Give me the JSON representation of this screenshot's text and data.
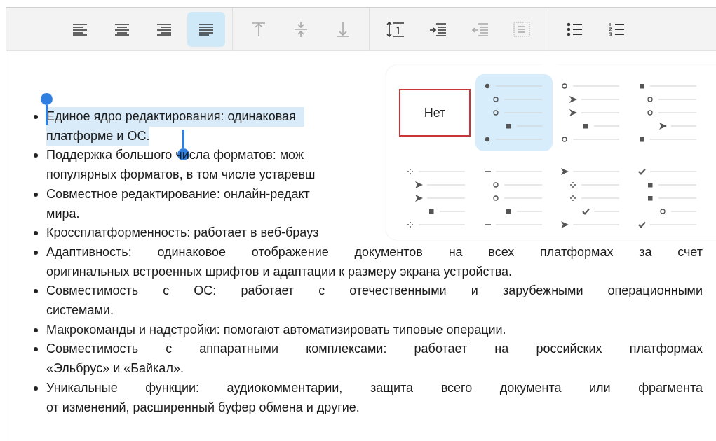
{
  "toolbar": {
    "groups": [
      [
        {
          "kind": "left",
          "selected": false,
          "disabled": false
        },
        {
          "kind": "center",
          "selected": false,
          "disabled": false
        },
        {
          "kind": "right",
          "selected": false,
          "disabled": false
        },
        {
          "kind": "justify",
          "selected": true,
          "disabled": false
        }
      ],
      [
        {
          "kind": "top",
          "selected": false,
          "disabled": true
        },
        {
          "kind": "middle",
          "selected": false,
          "disabled": true
        },
        {
          "kind": "bottom",
          "selected": false,
          "disabled": true
        }
      ],
      [
        {
          "kind": "spacing",
          "selected": false,
          "disabled": false
        },
        {
          "kind": "indent",
          "selected": false,
          "disabled": false
        },
        {
          "kind": "outdent",
          "selected": false,
          "disabled": true
        },
        {
          "kind": "wrap",
          "selected": false,
          "disabled": true
        }
      ],
      [
        {
          "kind": "bullets",
          "selected": false,
          "disabled": false
        },
        {
          "kind": "numbers",
          "selected": false,
          "disabled": false
        }
      ]
    ]
  },
  "document": {
    "items": [
      {
        "selected": true,
        "lines": [
          "Единое ядро редактирования: одинаковая",
          "платформе и ОС."
        ]
      },
      {
        "selected": false,
        "lines": [
          "Поддержка большого числа форматов: мож",
          "популярных форматов, в том числе устаревш"
        ]
      },
      {
        "selected": false,
        "lines": [
          "Совместное редактирование: онлайн-редакт",
          "мира."
        ]
      },
      {
        "selected": false,
        "lines": [
          "Кроссплатформенность: работает в веб-брауз"
        ]
      },
      {
        "selected": false,
        "lines": [
          "Адаптивность: одинаковое отображение документов на всех платформах за счет",
          "оригинальных встроенных шрифтов и адаптации к размеру экрана устройства."
        ]
      },
      {
        "selected": false,
        "lines": [
          "Совместимость с ОС: работает с отечественными и зарубежными операционными",
          "системами."
        ]
      },
      {
        "selected": false,
        "lines": [
          "Макрокоманды и надстройки: помогают автоматизировать типовые операции."
        ]
      },
      {
        "selected": false,
        "lines": [
          "Совместимость с аппаратными комплексами: работает на российских платформах",
          "«Эльбрус» и «Байкал»."
        ]
      },
      {
        "selected": false,
        "lines": [
          "Уникальные функции: аудиокомментарии, защита всего документа или фрагмента",
          "от изменений, расширенный буфер обмена и другие."
        ]
      }
    ]
  },
  "bullet_popover": {
    "options": [
      {
        "kind": "none",
        "label": "Нет",
        "selected": false,
        "focused": true
      },
      {
        "kind": "style",
        "markers": [
          {
            "kind": "dot"
          },
          {
            "kind": "circle"
          },
          {
            "kind": "circle"
          },
          {
            "kind": "square"
          },
          {
            "kind": "dot"
          }
        ],
        "selected": true,
        "focused": false
      },
      {
        "kind": "style",
        "markers": [
          {
            "kind": "circle"
          },
          {
            "kind": "arrow"
          },
          {
            "kind": "arrow"
          },
          {
            "kind": "square"
          },
          {
            "kind": "circle"
          }
        ],
        "selected": false,
        "focused": false
      },
      {
        "kind": "style",
        "markers": [
          {
            "kind": "square"
          },
          {
            "kind": "circle"
          },
          {
            "kind": "circle"
          },
          {
            "kind": "arrow"
          },
          {
            "kind": "square"
          }
        ],
        "selected": false,
        "focused": false
      },
      {
        "kind": "style",
        "markers": [
          {
            "kind": "dots"
          },
          {
            "kind": "arrow"
          },
          {
            "kind": "arrow"
          },
          {
            "kind": "square"
          },
          {
            "kind": "dots"
          }
        ],
        "selected": false,
        "focused": false
      },
      {
        "kind": "style",
        "markers": [
          {
            "kind": "dash"
          },
          {
            "kind": "circle"
          },
          {
            "kind": "circle"
          },
          {
            "kind": "square"
          },
          {
            "kind": "dash"
          }
        ],
        "selected": false,
        "focused": false
      },
      {
        "kind": "style",
        "markers": [
          {
            "kind": "arrow"
          },
          {
            "kind": "dots"
          },
          {
            "kind": "dots"
          },
          {
            "kind": "check"
          },
          {
            "kind": "arrow"
          }
        ],
        "selected": false,
        "focused": false
      },
      {
        "kind": "style",
        "markers": [
          {
            "kind": "check"
          },
          {
            "kind": "square"
          },
          {
            "kind": "square"
          },
          {
            "kind": "circle"
          },
          {
            "kind": "check"
          }
        ],
        "selected": false,
        "focused": false
      }
    ]
  }
}
